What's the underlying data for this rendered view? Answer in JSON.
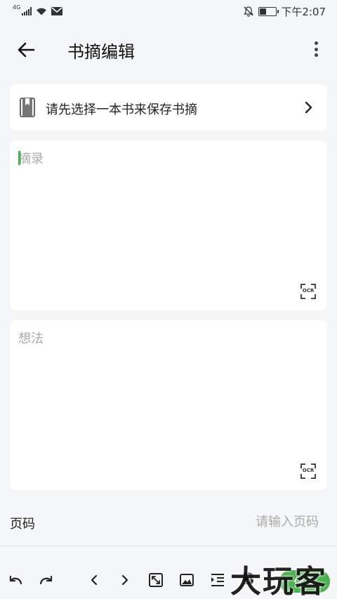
{
  "status_bar": {
    "network": "4G",
    "time": "下午2:07",
    "battery_level": 0.4
  },
  "header": {
    "title": "书摘编辑"
  },
  "book_select": {
    "label": "请先选择一本书来保存书摘"
  },
  "excerpt": {
    "placeholder": "摘录",
    "value": ""
  },
  "thought": {
    "placeholder": "想法",
    "value": ""
  },
  "ocr_label": "OCR",
  "page": {
    "label": "页码",
    "placeholder": "请输入页码",
    "value": ""
  },
  "toolbar": {
    "bold_label": "B",
    "save_label": "保存"
  },
  "watermark": "大玩客",
  "colors": {
    "accent": "#4caf50",
    "background": "#f5f6f8",
    "card": "#ffffff",
    "placeholder": "#aaaaaa"
  }
}
